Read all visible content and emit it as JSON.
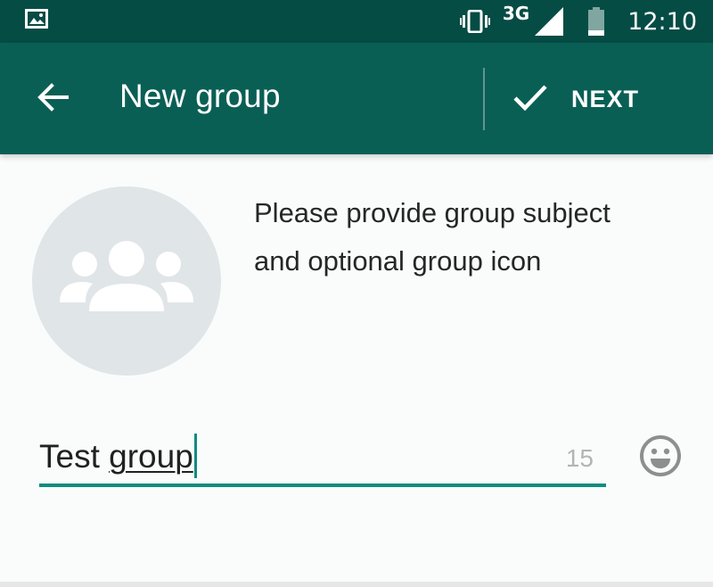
{
  "status_bar": {
    "network_type": "3G",
    "time": "12:10",
    "icons": [
      "image-notification-icon",
      "vibrate-icon",
      "signal-icon",
      "battery-icon"
    ]
  },
  "app_bar": {
    "title": "New group",
    "next_label": "NEXT",
    "icons": [
      "back-arrow-icon",
      "check-icon"
    ]
  },
  "content": {
    "prompt_line1": "Please provide group subject",
    "prompt_line2": "and optional group icon",
    "avatar_icon": "group-icon"
  },
  "subject_input": {
    "value_word1": "Test ",
    "value_word2": "group",
    "remaining_chars": "15",
    "emoji_icon": "smiley-icon"
  },
  "colors": {
    "status_bar": "#054c44",
    "app_bar": "#0a5f55",
    "accent": "#0e8c7f",
    "avatar_bg": "#e0e5e8"
  }
}
